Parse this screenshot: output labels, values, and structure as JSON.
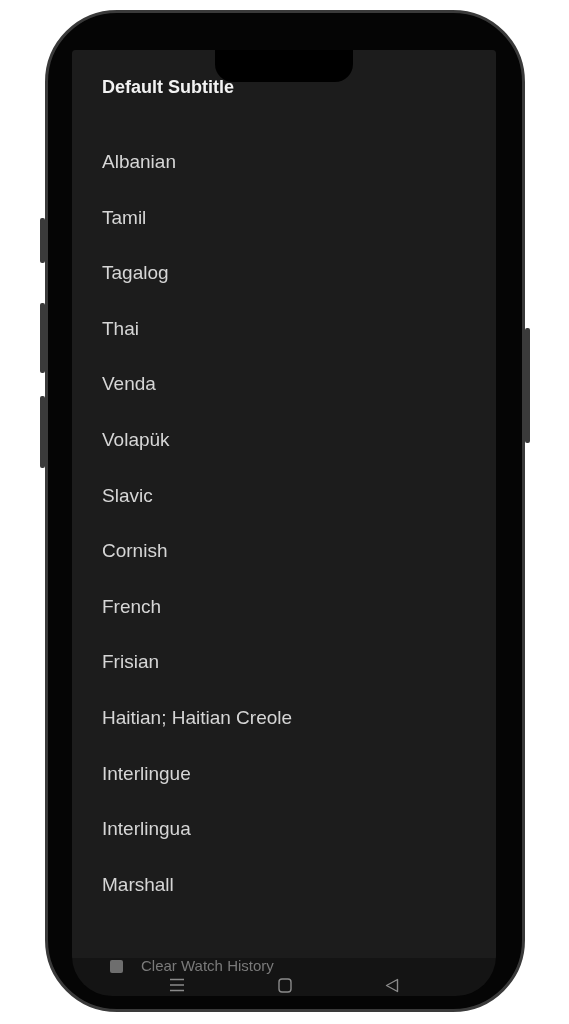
{
  "dialog": {
    "title": "Default Subtitle",
    "options": [
      {
        "label": "Albanian"
      },
      {
        "label": "Tamil"
      },
      {
        "label": "Tagalog"
      },
      {
        "label": "Thai"
      },
      {
        "label": "Venda"
      },
      {
        "label": "Volapük"
      },
      {
        "label": "Slavic"
      },
      {
        "label": "Cornish"
      },
      {
        "label": "French"
      },
      {
        "label": "Frisian"
      },
      {
        "label": "Haitian; Haitian Creole"
      },
      {
        "label": "Interlingue"
      },
      {
        "label": "Interlingua"
      },
      {
        "label": "Marshall"
      }
    ]
  },
  "background_setting": {
    "label": "Clear Watch History",
    "checked": false
  }
}
